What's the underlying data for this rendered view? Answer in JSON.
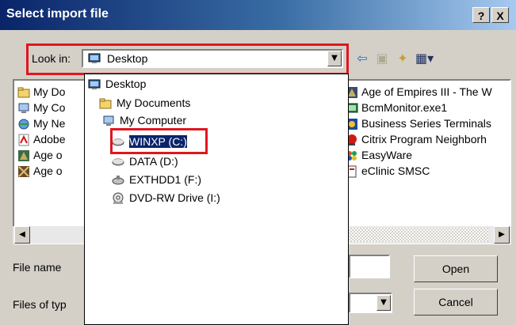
{
  "window": {
    "title": "Select import file",
    "help_button": "?",
    "close_button": "X"
  },
  "lookin": {
    "label": "Look in:",
    "value": "Desktop"
  },
  "list_items_left": [
    {
      "label": "My Do",
      "icon": "folder-documents-icon"
    },
    {
      "label": "My Co",
      "icon": "computer-icon"
    },
    {
      "label": "My Ne",
      "icon": "network-icon"
    },
    {
      "label": "Adobe",
      "icon": "pdf-shortcut-icon"
    },
    {
      "label": "Age o",
      "icon": "game-shortcut-icon"
    },
    {
      "label": "Age o",
      "icon": "game-shortcut-icon"
    }
  ],
  "list_items_right": [
    {
      "label": "Age of Empires III - The W",
      "icon": "game-shortcut-icon"
    },
    {
      "label": "BcmMonitor.exe1",
      "icon": "app-shortcut-icon"
    },
    {
      "label": "Business Series Terminals",
      "icon": "app-shortcut-icon"
    },
    {
      "label": "Citrix Program Neighborh",
      "icon": "app-shortcut-icon"
    },
    {
      "label": "EasyWare",
      "icon": "app-shortcut-icon"
    },
    {
      "label": "eClinic SMSC",
      "icon": "app-shortcut-icon"
    }
  ],
  "dropdown_items": [
    {
      "label": "Desktop",
      "icon": "desktop-icon"
    },
    {
      "label": "My Documents",
      "icon": "folder-documents-icon"
    },
    {
      "label": "My Computer",
      "icon": "computer-icon"
    },
    {
      "label": "WINXP (C:)",
      "icon": "hard-drive-icon",
      "selected": true
    },
    {
      "label": "DATA (D:)",
      "icon": "hard-drive-icon"
    },
    {
      "label": "EXTHDD1 (F:)",
      "icon": "hard-drive-icon"
    },
    {
      "label": "DVD-RW Drive (I:)",
      "icon": "dvd-drive-icon"
    }
  ],
  "file_name": {
    "label": "File name",
    "value": ""
  },
  "file_type": {
    "label": "Files of typ",
    "value": ""
  },
  "buttons": {
    "open": "Open",
    "cancel": "Cancel"
  },
  "colors": {
    "title_bar": "#0a246a",
    "highlight_box": "#e0161f",
    "selection": "#0a246a"
  }
}
